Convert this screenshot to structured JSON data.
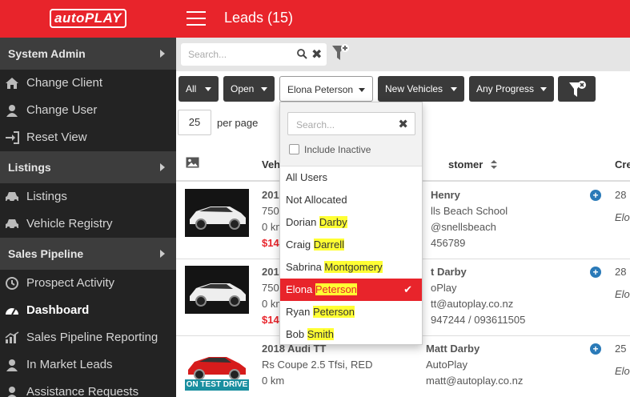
{
  "app": {
    "logo_text": "autoPLAY",
    "page_title": "Leads (15)"
  },
  "sidebar": {
    "sections": [
      {
        "title": "System Admin",
        "items": [
          {
            "label": "Change Client",
            "icon": "home-icon"
          },
          {
            "label": "Change User",
            "icon": "user-icon"
          },
          {
            "label": "Reset View",
            "icon": "sign-in-icon"
          }
        ]
      },
      {
        "title": "Listings",
        "items": [
          {
            "label": "Listings",
            "icon": "car-icon"
          },
          {
            "label": "Vehicle Registry",
            "icon": "car-icon"
          }
        ]
      },
      {
        "title": "Sales Pipeline",
        "items": [
          {
            "label": "Prospect Activity",
            "icon": "clock-icon"
          },
          {
            "label": "Dashboard",
            "icon": "dashboard-icon",
            "active": true
          },
          {
            "label": "Sales Pipeline Reporting",
            "icon": "chart-icon"
          },
          {
            "label": "In Market Leads",
            "icon": "user-icon"
          },
          {
            "label": "Assistance Requests",
            "icon": "user-icon"
          }
        ]
      }
    ]
  },
  "search": {
    "placeholder": "Search..."
  },
  "filters": {
    "all": "All",
    "status": "Open",
    "user": "Elona Peterson",
    "vehicle_type": "New Vehicles",
    "progress": "Any Progress"
  },
  "pagination": {
    "per_page": "25",
    "per_page_label": "per page"
  },
  "table": {
    "headers": {
      "vehicle": "Vehi",
      "customer": "stomer",
      "created": "Cre"
    },
    "rows": [
      {
        "title": "201",
        "line2": "750",
        "line3": "0 km",
        "price": "$14",
        "cust_name": "Henry",
        "cust_line2": "lls Beach School",
        "cust_line3": "@snellsbeach",
        "cust_line4": "456789",
        "date": "28",
        "assignee": "Elo",
        "badge": ""
      },
      {
        "title": "201",
        "line2": "750",
        "line3": "0 km",
        "price": "$14",
        "cust_name": "t Darby",
        "cust_line2": "oPlay",
        "cust_line3": "tt@autoplay.co.nz",
        "cust_line4": "947244 / 093611505",
        "date": "28",
        "assignee": "Elo",
        "badge": ""
      },
      {
        "title": "2018 Audi TT",
        "line2": "Rs Coupe 2.5 Tfsi, RED",
        "line3": "0 km",
        "price": "",
        "cust_name": "Matt Darby",
        "cust_line2": "AutoPlay",
        "cust_line3": "matt@autoplay.co.nz",
        "cust_line4": "",
        "date": "25",
        "assignee": "Elo",
        "badge": "ON TEST DRIVE"
      }
    ]
  },
  "dropdown": {
    "search_placeholder": "Search...",
    "include_inactive": "Include Inactive",
    "options": [
      {
        "first": "All Users",
        "last": ""
      },
      {
        "first": "Not Allocated",
        "last": ""
      },
      {
        "first": "Dorian ",
        "last": "Darby"
      },
      {
        "first": "Craig ",
        "last": "Darrell"
      },
      {
        "first": "Sabrina ",
        "last": "Montgomery"
      },
      {
        "first": "Elona ",
        "last": "Peterson",
        "selected": true
      },
      {
        "first": "Ryan ",
        "last": "Peterson"
      },
      {
        "first": "Bob ",
        "last": "Smith"
      }
    ]
  },
  "colors": {
    "brand_red": "#e8242b",
    "sidebar_bg": "#232323",
    "highlight": "#ffff33",
    "link_blue": "#2a7ab8"
  }
}
